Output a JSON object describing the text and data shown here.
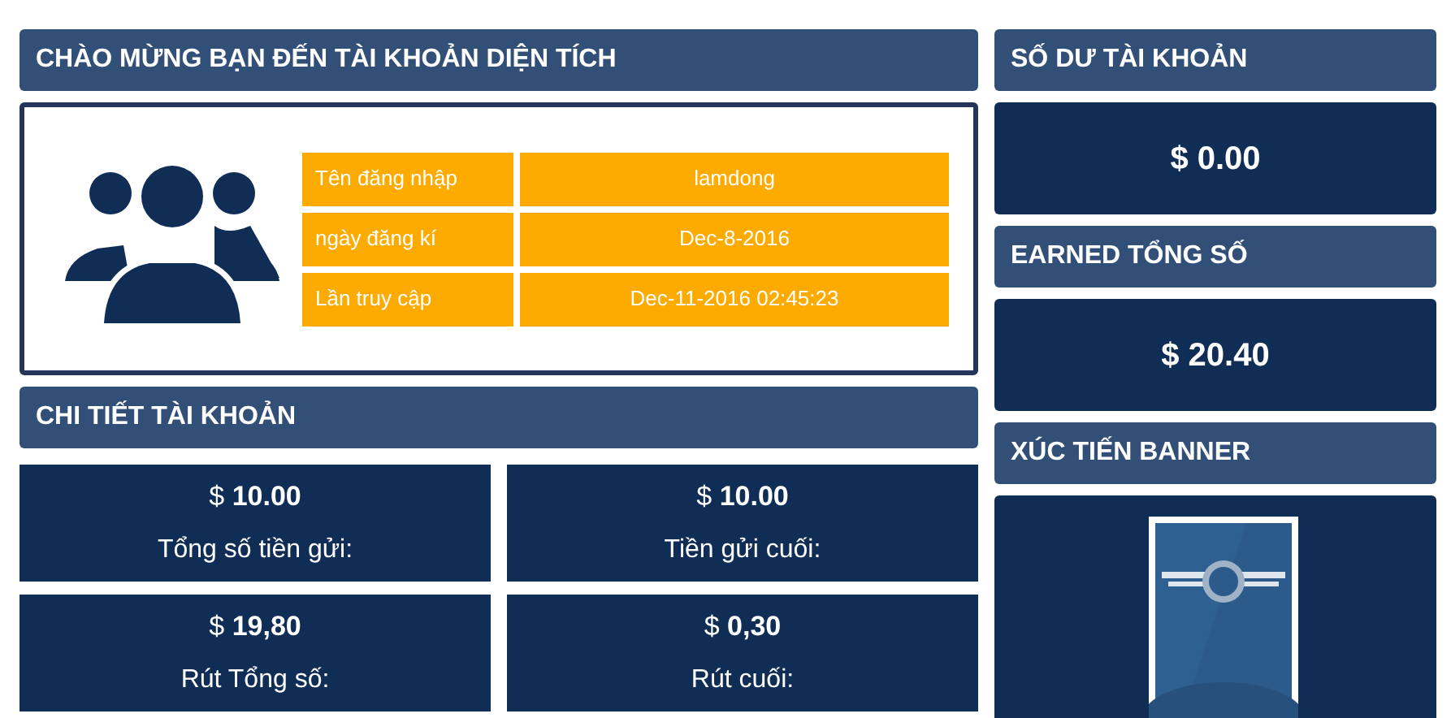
{
  "welcome": {
    "title": "CHÀO MỪNG BẠN ĐẾN TÀI KHOẢN DIỆN TÍCH",
    "info": [
      {
        "label": "Tên đăng nhập",
        "value": "lamdong"
      },
      {
        "label": "ngày đăng kí",
        "value": "Dec-8-2016"
      },
      {
        "label": "Lần truy cập",
        "value": "Dec-11-2016 02:45:23"
      }
    ]
  },
  "details": {
    "title": "CHI TIẾT TÀI KHOẢN",
    "stats": [
      {
        "amount": "$ **10.00**",
        "label": "Tổng số tiền gửi:"
      },
      {
        "amount": "$ **10.00**",
        "label": "Tiền gửi cuối:"
      },
      {
        "amount": "$ **19,80**",
        "label": "Rút Tổng số:"
      },
      {
        "amount": "$ **0,30**",
        "label": "Rút cuối:"
      }
    ]
  },
  "balance": {
    "title": "SỐ DƯ TÀI KHOẢN",
    "value": "$ 0.00"
  },
  "earned": {
    "title": "EARNED TỔNG SỐ",
    "value": "$ 20.40"
  },
  "banner": {
    "title": "XÚC TIẾN BANNER"
  }
}
